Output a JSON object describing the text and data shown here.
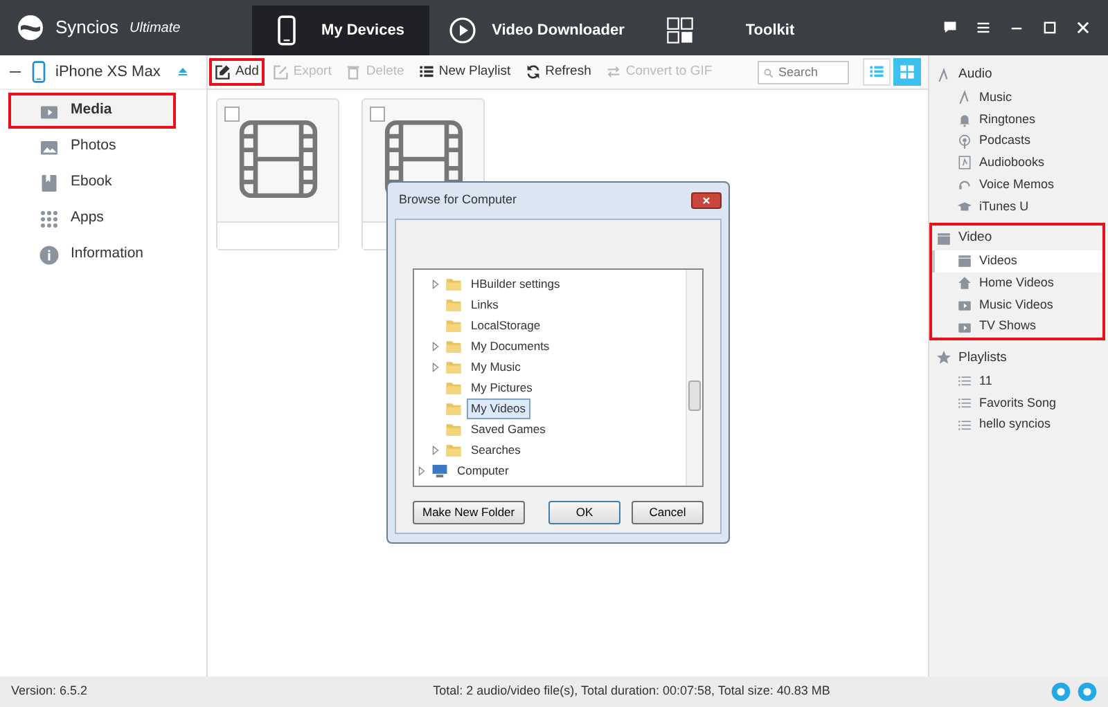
{
  "app": {
    "name": "Syncios",
    "edition": "Ultimate"
  },
  "nav_tabs": [
    {
      "label": "My Devices",
      "selected": true
    },
    {
      "label": "Video Downloader",
      "selected": false
    },
    {
      "label": "Toolkit",
      "selected": false
    }
  ],
  "device": {
    "name": "iPhone XS Max"
  },
  "sidebar": {
    "items": [
      {
        "label": "Media",
        "selected": true,
        "highlighted": true
      },
      {
        "label": "Photos",
        "selected": false,
        "highlighted": false
      },
      {
        "label": "Ebook",
        "selected": false,
        "highlighted": false
      },
      {
        "label": "Apps",
        "selected": false,
        "highlighted": false
      },
      {
        "label": "Information",
        "selected": false,
        "highlighted": false
      }
    ]
  },
  "toolbar": {
    "buttons": [
      {
        "label": "Add",
        "disabled": false,
        "highlighted": true
      },
      {
        "label": "Export",
        "disabled": true,
        "highlighted": false
      },
      {
        "label": "Delete",
        "disabled": true,
        "highlighted": false
      },
      {
        "label": "New Playlist",
        "disabled": false,
        "highlighted": false
      },
      {
        "label": "Refresh",
        "disabled": false,
        "highlighted": false
      },
      {
        "label": "Convert to GIF",
        "disabled": true,
        "highlighted": false
      }
    ],
    "search": {
      "placeholder": "Search"
    },
    "views": [
      {
        "selected": false
      },
      {
        "selected": true
      }
    ]
  },
  "media_items": [
    {
      "checked": false
    },
    {
      "checked": false
    }
  ],
  "library": {
    "groups": [
      {
        "label": "Audio",
        "highlighted": false,
        "items": [
          {
            "label": "Music",
            "selected": false
          },
          {
            "label": "Ringtones",
            "selected": false
          },
          {
            "label": "Podcasts",
            "selected": false
          },
          {
            "label": "Audiobooks",
            "selected": false
          },
          {
            "label": "Voice Memos",
            "selected": false
          },
          {
            "label": "iTunes U",
            "selected": false
          }
        ]
      },
      {
        "label": "Video",
        "highlighted": true,
        "items": [
          {
            "label": "Videos",
            "selected": true
          },
          {
            "label": "Home Videos",
            "selected": false
          },
          {
            "label": "Music Videos",
            "selected": false
          },
          {
            "label": "TV Shows",
            "selected": false
          }
        ]
      },
      {
        "label": "Playlists",
        "highlighted": false,
        "items": [
          {
            "label": "11",
            "selected": false
          },
          {
            "label": "Favorits Song",
            "selected": false
          },
          {
            "label": "hello syncios",
            "selected": false
          }
        ]
      }
    ]
  },
  "dialog": {
    "title": "Browse for Computer",
    "tree": [
      {
        "children": [
          {
            "label": "HBuilder settings",
            "expandable": true,
            "selected": false
          },
          {
            "label": "Links",
            "expandable": false,
            "selected": false
          },
          {
            "label": "LocalStorage",
            "expandable": false,
            "selected": false
          },
          {
            "label": "My Documents",
            "expandable": true,
            "selected": false
          },
          {
            "label": "My Music",
            "expandable": true,
            "selected": false
          },
          {
            "label": "My Pictures",
            "expandable": false,
            "selected": false
          },
          {
            "label": "My Videos",
            "expandable": false,
            "selected": true
          },
          {
            "label": "Saved Games",
            "expandable": false,
            "selected": false
          },
          {
            "label": "Searches",
            "expandable": true,
            "selected": false
          }
        ]
      },
      {
        "label": "Computer",
        "expandable": true,
        "selected": false
      }
    ],
    "buttons": [
      {
        "label": "Make New Folder",
        "kind": "secondary"
      },
      {
        "label": "OK",
        "kind": "default"
      },
      {
        "label": "Cancel",
        "kind": "secondary"
      }
    ]
  },
  "status_bar": {
    "version": "Version: 6.5.2",
    "summary": "Total: 2 audio/video file(s), Total duration: 00:07:58, Total size: 40.83 MB"
  }
}
